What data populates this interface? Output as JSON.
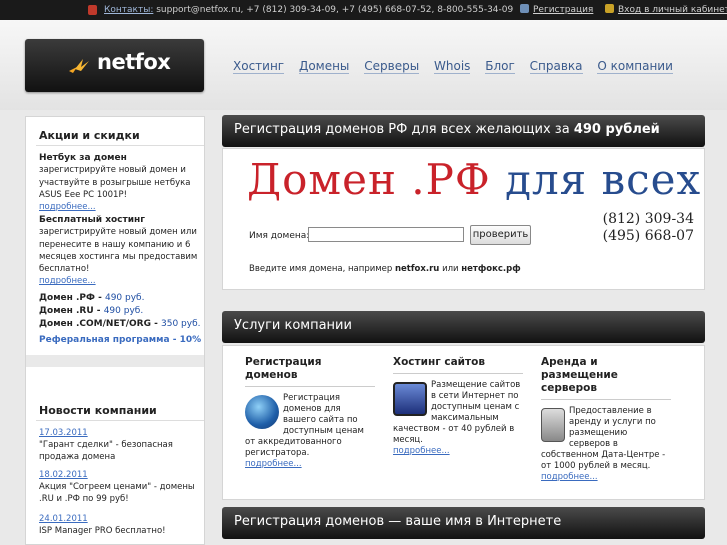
{
  "topbar": {
    "contacts_label": "Контакты:",
    "contacts_value": "support@netfox.ru, +7 (812) 309-34-09, +7 (495) 668-07-52, 8-800-555-34-09",
    "register": "Регистрация",
    "login": "Вход в личный кабинет"
  },
  "logo": {
    "text": "netfox"
  },
  "nav": [
    "Хостинг",
    "Домены",
    "Серверы",
    "Whois",
    "Блог",
    "Справка",
    "О компании"
  ],
  "sidebar": {
    "promo_title": "Акции и скидки",
    "promos": [
      {
        "title": "Нетбук за домен",
        "text": "зарегистрируйте новый домен и участвуйте в розыгрыше нетбука ASUS Eee PC 1001P!",
        "more": "подробнее..."
      },
      {
        "title": "Бесплатный хостинг",
        "text": "зарегистрируйте новый домен или перенесите в нашу компанию и 6 месяцев хостинга мы предоставим бесплатно!",
        "more": "подробнее..."
      }
    ],
    "prices": [
      {
        "label": "Домен .РФ -",
        "price": "490 руб."
      },
      {
        "label": "Домен .RU -",
        "price": "490 руб."
      },
      {
        "label": "Домен .COM/NET/ORG -",
        "price": "350 руб."
      }
    ],
    "referral": "Реферальная программа - 10%",
    "news_title": "Новости компании",
    "news": [
      {
        "date": "17.03.2011",
        "text": "\"Гарант сделки\" - безопасная продажа домена"
      },
      {
        "date": "18.02.2011",
        "text": "Акция \"Согреем ценами\" - домены .RU и .РФ по 99 руб!"
      },
      {
        "date": "24.01.2011",
        "text": "ISP Manager PRO бесплатно!"
      }
    ]
  },
  "domain_panel": {
    "title": "Регистрация доменов РФ для всех желающих за",
    "price": "490 рублей",
    "banner_red": "Домен .РФ ",
    "banner_blue": "для всех",
    "phone1": "(812) 309-34",
    "phone2": "(495) 668-07",
    "field_label": "Имя домена:",
    "field_value": "",
    "button": "проверить",
    "hint_prefix": "Введите имя домена, например",
    "hint_ex1": "netfox.ru",
    "hint_or": "или",
    "hint_ex2": "нетфокс.рф"
  },
  "services": {
    "title": "Услуги компании",
    "items": [
      {
        "title": "Регистрация доменов",
        "text": "Регистрация доменов для вашего сайта по доступным ценам от аккредитованного регистратора.",
        "more": "подробнее...",
        "icon": "globe-icon"
      },
      {
        "title": "Хостинг сайтов",
        "text": "Размещение сайтов в сети Интернет по доступным ценам с максимальным качеством - от 40 рублей в месяц.",
        "more": "подробнее...",
        "icon": "monitor-icon"
      },
      {
        "title": "Аренда и размещение серверов",
        "text": "Предоставление в аренду и услуги по размещению серверов в собственном Дата-Центре - от 1000 рублей в месяц.",
        "more": "подробнее...",
        "icon": "server-icon"
      }
    ]
  },
  "bottom_panel": {
    "title": "Регистрация доменов — ваше имя в Интернете"
  }
}
